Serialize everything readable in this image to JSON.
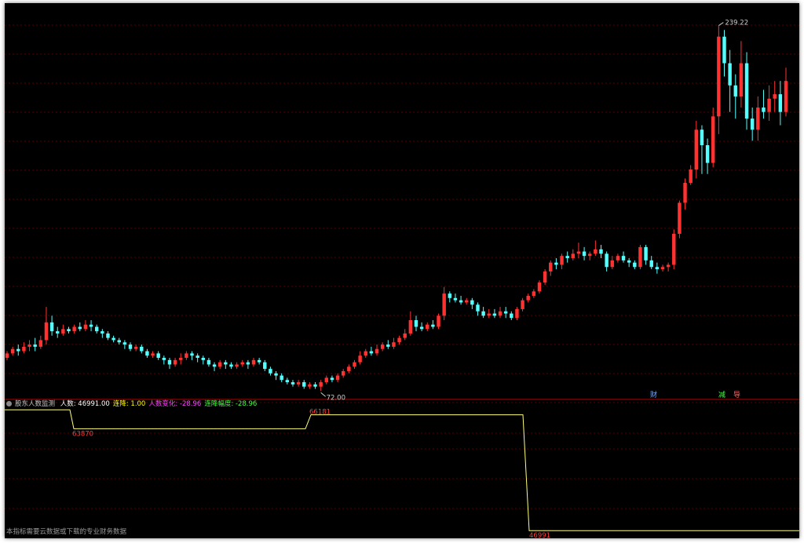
{
  "colors": {
    "up": "#ff3232",
    "down": "#54ffff",
    "grid": "#5a0000",
    "panel_divider": "#b40000",
    "indicator_line": "#ffff7a",
    "label_red": "#ff3c3c"
  },
  "price_panel": {
    "high_label": "239.22",
    "low_label": "72.00",
    "marker_cai": "财",
    "marker_jian": "减",
    "marker_dao": "导"
  },
  "indicator_panel": {
    "name": "股东人数监测",
    "items": [
      {
        "label": "人数: 46991.00",
        "color": "#ffffff"
      },
      {
        "label": "连降: 1.00",
        "color": "#ffff00"
      },
      {
        "label": "人数变化: -28.96",
        "color": "#ff44ff"
      },
      {
        "label": "连降幅度: -28.96",
        "color": "#44ff44"
      }
    ],
    "level_labels": [
      "63870",
      "66181",
      "46991"
    ]
  },
  "footnote": "本指标需要云数据或下载的专业财务数据",
  "chart_data": {
    "type": "candlestick",
    "y_high_marker": 239.22,
    "y_low_marker": 72.0,
    "ylim": [
      70,
      245
    ],
    "candles": [
      [
        87,
        89,
        86,
        90
      ],
      [
        89,
        91,
        88,
        92
      ],
      [
        91,
        90,
        88,
        93
      ],
      [
        90,
        92,
        89,
        94
      ],
      [
        92,
        93,
        90,
        95
      ],
      [
        93,
        92,
        90,
        96
      ],
      [
        92,
        95,
        91,
        97
      ],
      [
        95,
        103,
        93,
        110
      ],
      [
        103,
        99,
        97,
        106
      ],
      [
        99,
        98,
        96,
        101
      ],
      [
        98,
        100,
        97,
        102
      ],
      [
        100,
        99,
        98,
        101
      ],
      [
        99,
        101,
        98,
        102
      ],
      [
        101,
        100,
        99,
        103
      ],
      [
        100,
        102,
        99,
        104
      ],
      [
        102,
        101,
        99,
        104
      ],
      [
        101,
        99,
        98,
        102
      ],
      [
        99,
        98,
        96,
        100
      ],
      [
        98,
        96,
        95,
        99
      ],
      [
        96,
        95,
        94,
        97
      ],
      [
        95,
        94,
        93,
        96
      ],
      [
        94,
        93,
        91,
        95
      ],
      [
        93,
        91,
        90,
        94
      ],
      [
        91,
        92,
        90,
        93
      ],
      [
        92,
        90,
        89,
        93
      ],
      [
        90,
        88,
        87,
        91
      ],
      [
        88,
        89,
        87,
        90
      ],
      [
        89,
        87,
        86,
        90
      ],
      [
        87,
        86,
        84,
        88
      ],
      [
        86,
        84,
        82,
        87
      ],
      [
        84,
        86,
        83,
        87
      ],
      [
        86,
        87,
        84,
        89
      ],
      [
        87,
        89,
        86,
        90
      ],
      [
        89,
        88,
        86,
        90
      ],
      [
        88,
        87,
        85,
        89
      ],
      [
        87,
        86,
        84,
        88
      ],
      [
        86,
        84,
        83,
        87
      ],
      [
        84,
        83,
        81,
        85
      ],
      [
        83,
        85,
        82,
        86
      ],
      [
        85,
        84,
        82,
        86
      ],
      [
        84,
        83,
        82,
        85
      ],
      [
        83,
        84,
        82,
        85
      ],
      [
        84,
        85,
        83,
        86
      ],
      [
        85,
        84,
        82,
        86
      ],
      [
        84,
        86,
        83,
        87
      ],
      [
        86,
        85,
        84,
        87
      ],
      [
        85,
        82,
        81,
        86
      ],
      [
        82,
        80,
        79,
        83
      ],
      [
        80,
        79,
        77,
        81
      ],
      [
        79,
        77,
        76,
        80
      ],
      [
        77,
        76,
        75,
        78
      ],
      [
        76,
        75,
        74,
        77
      ],
      [
        75,
        76,
        74,
        77
      ],
      [
        76,
        74,
        73,
        77
      ],
      [
        74,
        75,
        73,
        76
      ],
      [
        75,
        74,
        73,
        76
      ],
      [
        74,
        76,
        72,
        77
      ],
      [
        76,
        78,
        75,
        79
      ],
      [
        78,
        77,
        76,
        79
      ],
      [
        77,
        79,
        76,
        80
      ],
      [
        79,
        81,
        78,
        82
      ],
      [
        81,
        83,
        80,
        84
      ],
      [
        83,
        85,
        82,
        86
      ],
      [
        85,
        88,
        84,
        90
      ],
      [
        88,
        90,
        87,
        91
      ],
      [
        90,
        89,
        88,
        92
      ],
      [
        89,
        91,
        88,
        93
      ],
      [
        91,
        93,
        90,
        94
      ],
      [
        93,
        92,
        91,
        95
      ],
      [
        92,
        94,
        91,
        96
      ],
      [
        94,
        96,
        93,
        97
      ],
      [
        96,
        98,
        95,
        100
      ],
      [
        98,
        104,
        97,
        108
      ],
      [
        104,
        101,
        99,
        106
      ],
      [
        101,
        100,
        99,
        103
      ],
      [
        100,
        102,
        99,
        103
      ],
      [
        102,
        101,
        100,
        104
      ],
      [
        101,
        106,
        100,
        107
      ],
      [
        106,
        116,
        104,
        119
      ],
      [
        116,
        114,
        112,
        117
      ],
      [
        114,
        113,
        112,
        116
      ],
      [
        113,
        112,
        111,
        115
      ],
      [
        112,
        113,
        111,
        114
      ],
      [
        113,
        111,
        109,
        114
      ],
      [
        111,
        108,
        106,
        112
      ],
      [
        108,
        106,
        105,
        110
      ],
      [
        106,
        107,
        105,
        109
      ],
      [
        107,
        106,
        105,
        109
      ],
      [
        106,
        108,
        105,
        110
      ],
      [
        108,
        107,
        105,
        110
      ],
      [
        107,
        105,
        104,
        108
      ],
      [
        105,
        109,
        104,
        110
      ],
      [
        109,
        113,
        108,
        114
      ],
      [
        113,
        115,
        112,
        116
      ],
      [
        115,
        117,
        114,
        118
      ],
      [
        117,
        121,
        116,
        122
      ],
      [
        121,
        126,
        120,
        127
      ],
      [
        126,
        130,
        124,
        131
      ],
      [
        130,
        129,
        127,
        132
      ],
      [
        129,
        133,
        127,
        134
      ],
      [
        133,
        132,
        130,
        135
      ],
      [
        132,
        134,
        131,
        136
      ],
      [
        134,
        135,
        132,
        139
      ],
      [
        135,
        133,
        131,
        137
      ],
      [
        133,
        134,
        131,
        135
      ],
      [
        134,
        136,
        133,
        140
      ],
      [
        136,
        134,
        132,
        138
      ],
      [
        134,
        128,
        126,
        135
      ],
      [
        128,
        131,
        127,
        133
      ],
      [
        131,
        133,
        130,
        134
      ],
      [
        133,
        131,
        130,
        135
      ],
      [
        131,
        130,
        128,
        132
      ],
      [
        130,
        128,
        127,
        131
      ],
      [
        128,
        137,
        127,
        138
      ],
      [
        137,
        131,
        129,
        138
      ],
      [
        131,
        128,
        127,
        133
      ],
      [
        128,
        127,
        125,
        130
      ],
      [
        127,
        128,
        126,
        129
      ],
      [
        128,
        129,
        126,
        130
      ],
      [
        129,
        143,
        127,
        145
      ],
      [
        143,
        157,
        141,
        158
      ],
      [
        157,
        166,
        154,
        168
      ],
      [
        166,
        172,
        165,
        174
      ],
      [
        172,
        190,
        168,
        194
      ],
      [
        190,
        183,
        170,
        192
      ],
      [
        183,
        175,
        170,
        186
      ],
      [
        175,
        196,
        173,
        200
      ],
      [
        196,
        232,
        188,
        237
      ],
      [
        232,
        220,
        214,
        235
      ],
      [
        220,
        210,
        198,
        226
      ],
      [
        210,
        205,
        195,
        215
      ],
      [
        205,
        220,
        200,
        230
      ],
      [
        220,
        195,
        190,
        225
      ],
      [
        195,
        190,
        185,
        200
      ],
      [
        190,
        200,
        185,
        205
      ],
      [
        200,
        198,
        195,
        208
      ],
      [
        198,
        204,
        194,
        210
      ],
      [
        204,
        206,
        198,
        212
      ],
      [
        206,
        198,
        192,
        212
      ],
      [
        198,
        212,
        196,
        218
      ]
    ],
    "indicator_series": {
      "name": "人数",
      "values": [
        67000,
        67000,
        63870,
        63870,
        66181,
        66181,
        46991
      ]
    }
  }
}
